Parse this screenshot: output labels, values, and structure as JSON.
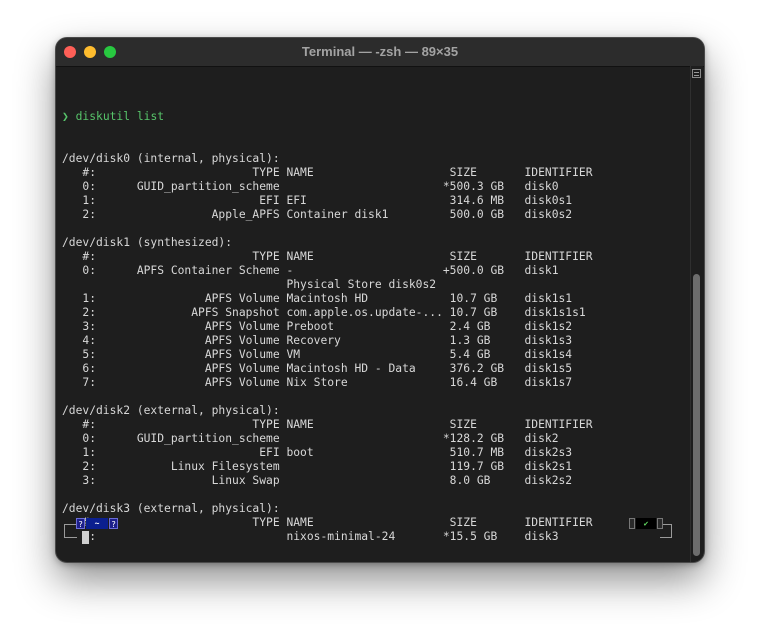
{
  "window": {
    "title": "Terminal — -zsh — 89×35"
  },
  "terminal": {
    "prompt_symbol": "❯",
    "command": "diskutil list",
    "lines": [
      "/dev/disk0 (internal, physical):",
      "   #:                       TYPE NAME                    SIZE       IDENTIFIER",
      "   0:      GUID_partition_scheme                        *500.3 GB   disk0",
      "   1:                        EFI EFI                     314.6 MB   disk0s1",
      "   2:                 Apple_APFS Container disk1         500.0 GB   disk0s2",
      "",
      "/dev/disk1 (synthesized):",
      "   #:                       TYPE NAME                    SIZE       IDENTIFIER",
      "   0:      APFS Container Scheme -                      +500.0 GB   disk1",
      "                                 Physical Store disk0s2",
      "   1:                APFS Volume Macintosh HD            10.7 GB    disk1s1",
      "   2:              APFS Snapshot com.apple.os.update-... 10.7 GB    disk1s1s1",
      "   3:                APFS Volume Preboot                 2.4 GB     disk1s2",
      "   4:                APFS Volume Recovery                1.3 GB     disk1s3",
      "   5:                APFS Volume VM                      5.4 GB     disk1s4",
      "   6:                APFS Volume Macintosh HD - Data     376.2 GB   disk1s5",
      "   7:                APFS Volume Nix Store               16.4 GB    disk1s7",
      "",
      "/dev/disk2 (external, physical):",
      "   #:                       TYPE NAME                    SIZE       IDENTIFIER",
      "   0:      GUID_partition_scheme                        *128.2 GB   disk2",
      "   1:                        EFI boot                    510.7 MB   disk2s3",
      "   2:           Linux Filesystem                         119.7 GB   disk2s1",
      "   3:                 Linux Swap                         8.0 GB     disk2s2",
      "",
      "/dev/disk3 (external, physical):",
      "   #:                       TYPE NAME                    SIZE       IDENTIFIER",
      "   0:                            nixos-minimal-24       *15.5 GB    disk3"
    ]
  },
  "prompt": {
    "left_marker": "?",
    "directory": "~",
    "right_marker": "?",
    "status": "✔"
  },
  "colors": {
    "background": "#1e1e1e",
    "text": "#d8d8d8",
    "prompt_green": "#57c46a",
    "dir_segment": "#0b1f8f"
  },
  "icons": {
    "close": "traffic-light-close-icon",
    "minimize": "traffic-light-minimize-icon",
    "zoom": "traffic-light-zoom-icon",
    "scroll": "scroll-menu-icon"
  }
}
